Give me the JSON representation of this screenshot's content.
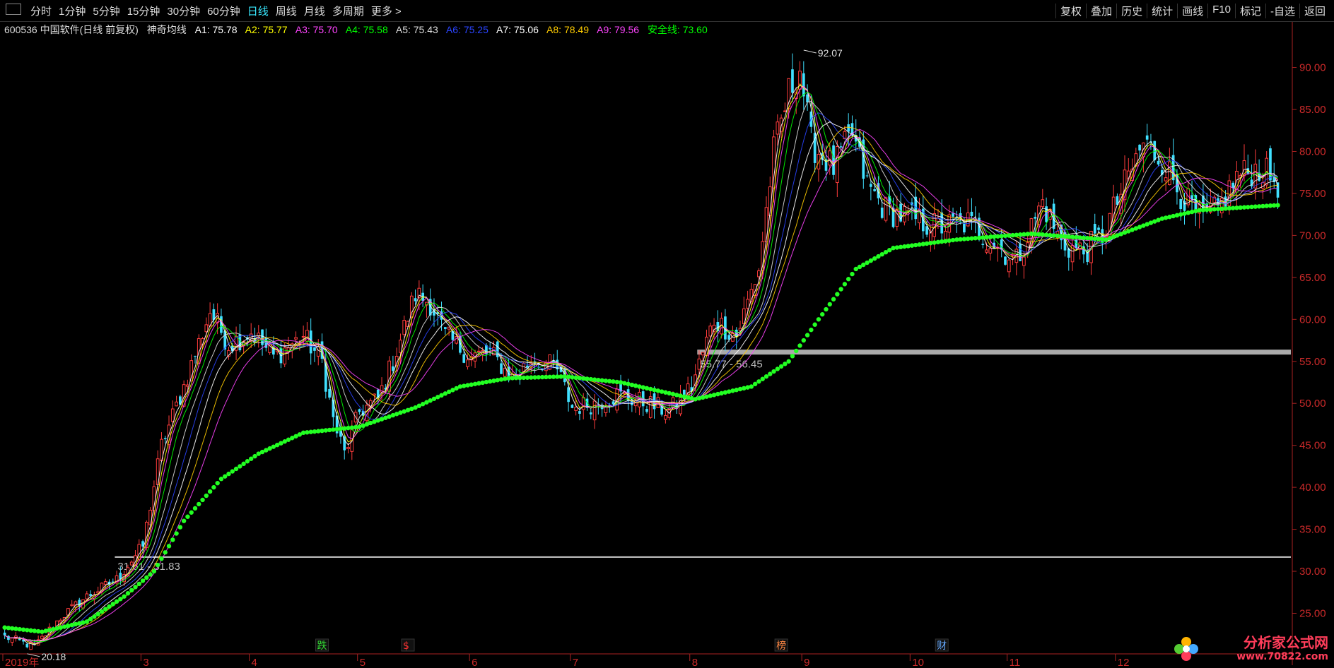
{
  "toolbar": {
    "periods": [
      "分时",
      "1分钟",
      "5分钟",
      "15分钟",
      "30分钟",
      "60分钟",
      "日线",
      "周线",
      "月线",
      "多周期",
      "更多 >"
    ],
    "active_period": "日线",
    "actions": [
      "复权",
      "叠加",
      "历史",
      "统计",
      "画线",
      "F10",
      "标记",
      "-自选",
      "返回"
    ]
  },
  "legend": {
    "stock": "600536 中国软件(日线 前复权)",
    "indicator": "神奇均线",
    "items": [
      {
        "label": "A1: 75.78",
        "color": "#ffffff"
      },
      {
        "label": "A2: 75.77",
        "color": "#ffff00"
      },
      {
        "label": "A3: 75.70",
        "color": "#ff44ff"
      },
      {
        "label": "A4: 75.58",
        "color": "#00ff00"
      },
      {
        "label": "A5: 75.43",
        "color": "#dddddd"
      },
      {
        "label": "A6: 75.25",
        "color": "#2a44ff"
      },
      {
        "label": "A7: 75.06",
        "color": "#ffffff"
      },
      {
        "label": "A8: 78.49",
        "color": "#ffcc00"
      },
      {
        "label": "A9: 79.56",
        "color": "#ff44ff"
      },
      {
        "label": "安全线: 73.60",
        "color": "#00ff00"
      }
    ]
  },
  "chart_data": {
    "type": "candlestick",
    "ylim": [
      20.5,
      94
    ],
    "y_ticks": [
      25,
      30,
      35,
      40,
      45,
      50,
      55,
      60,
      65,
      70,
      75,
      80,
      85,
      90
    ],
    "y_tick_labels": [
      "25.00",
      "30.00",
      "35.00",
      "40.00",
      "45.00",
      "50.00",
      "55.00",
      "60.00",
      "65.00",
      "70.00",
      "75.00",
      "80.00",
      "85.00",
      "90.00"
    ],
    "x_labels": [
      "2019年",
      "3",
      "4",
      "5",
      "6",
      "7",
      "8",
      "9",
      "10",
      "11",
      "12"
    ],
    "x_label_positions": [
      0,
      37,
      66,
      95,
      125,
      152,
      184,
      214,
      243,
      269,
      298
    ],
    "n_days": 345,
    "close_path": [
      [
        0,
        22.2
      ],
      [
        8,
        21.0
      ],
      [
        15,
        24.5
      ],
      [
        22,
        27.0
      ],
      [
        30,
        29.0
      ],
      [
        37,
        33.0
      ],
      [
        42,
        45.0
      ],
      [
        48,
        52.0
      ],
      [
        55,
        61.0
      ],
      [
        60,
        57.0
      ],
      [
        66,
        58.5
      ],
      [
        72,
        55.5
      ],
      [
        80,
        58.0
      ],
      [
        85,
        55.0
      ],
      [
        88,
        48.0
      ],
      [
        91,
        44.0
      ],
      [
        95,
        49.0
      ],
      [
        100,
        50.5
      ],
      [
        104,
        55.0
      ],
      [
        110,
        63.0
      ],
      [
        114,
        62.0
      ],
      [
        118,
        58.0
      ],
      [
        125,
        55.5
      ],
      [
        130,
        56.0
      ],
      [
        136,
        53.0
      ],
      [
        142,
        55.5
      ],
      [
        148,
        54.0
      ],
      [
        152,
        49.5
      ],
      [
        158,
        50.0
      ],
      [
        164,
        51.0
      ],
      [
        172,
        50.0
      ],
      [
        178,
        49.0
      ],
      [
        184,
        52.0
      ],
      [
        190,
        60.0
      ],
      [
        196,
        58.0
      ],
      [
        202,
        66.0
      ],
      [
        206,
        80.0
      ],
      [
        210,
        87.0
      ],
      [
        213,
        90.0
      ],
      [
        216,
        81.0
      ],
      [
        222,
        78.0
      ],
      [
        227,
        82.0
      ],
      [
        231,
        76.0
      ],
      [
        236,
        73.0
      ],
      [
        243,
        72.0
      ],
      [
        250,
        71.0
      ],
      [
        258,
        71.5
      ],
      [
        265,
        69.0
      ],
      [
        271,
        67.0
      ],
      [
        278,
        74.0
      ],
      [
        283,
        69.0
      ],
      [
        289,
        68.0
      ],
      [
        294,
        70.0
      ],
      [
        300,
        76.0
      ],
      [
        305,
        81.0
      ],
      [
        310,
        79.0
      ],
      [
        315,
        75.0
      ],
      [
        320,
        72.0
      ],
      [
        325,
        73.0
      ],
      [
        330,
        77.0
      ],
      [
        336,
        78.0
      ],
      [
        341,
        76.2
      ]
    ],
    "ma_lags": [
      1,
      2,
      3,
      5,
      8,
      11,
      14,
      18,
      22
    ],
    "ma_colors": [
      "#ffffff",
      "#ffff00",
      "#ff44ff",
      "#00ff00",
      "#dddddd",
      "#2a44ff",
      "#ffffff",
      "#ffcc00",
      "#ff44ff"
    ],
    "safety_line_path": [
      [
        0,
        23.3
      ],
      [
        10,
        22.8
      ],
      [
        22,
        24.0
      ],
      [
        32,
        27.0
      ],
      [
        40,
        30.0
      ],
      [
        48,
        36.0
      ],
      [
        58,
        41.0
      ],
      [
        68,
        44.0
      ],
      [
        80,
        46.5
      ],
      [
        95,
        47.2
      ],
      [
        110,
        49.5
      ],
      [
        122,
        52.0
      ],
      [
        135,
        53.0
      ],
      [
        150,
        53.2
      ],
      [
        165,
        52.5
      ],
      [
        185,
        50.5
      ],
      [
        200,
        52.0
      ],
      [
        210,
        55.0
      ],
      [
        218,
        60.0
      ],
      [
        228,
        66.0
      ],
      [
        238,
        68.5
      ],
      [
        255,
        69.5
      ],
      [
        275,
        70.2
      ],
      [
        295,
        69.5
      ],
      [
        310,
        72.0
      ],
      [
        320,
        73.0
      ],
      [
        341,
        73.6
      ]
    ],
    "annotations": [
      {
        "label": "92.07",
        "day": 214,
        "price": 92.07
      },
      {
        "label": "20.18",
        "day": 6,
        "price": 20.18
      }
    ],
    "hlines": [
      {
        "label": "31.61 - 31.83",
        "price": 31.7,
        "color": "#cccccc",
        "from_day": 30
      },
      {
        "label": "55.77 - 56.45",
        "price": 56.1,
        "color": "#aaaaaa",
        "from_day": 186
      }
    ],
    "event_markers": [
      {
        "label": "跌",
        "day": 85,
        "color": "#33dd33"
      },
      {
        "label": "$",
        "day": 108,
        "color": "#ff3333"
      },
      {
        "label": "榜",
        "day": 208,
        "color": "#ff8844"
      },
      {
        "label": "财",
        "day": 251,
        "color": "#66aaff"
      }
    ]
  },
  "watermark": {
    "name": "分析家公式网",
    "url": "www.70822.com"
  }
}
